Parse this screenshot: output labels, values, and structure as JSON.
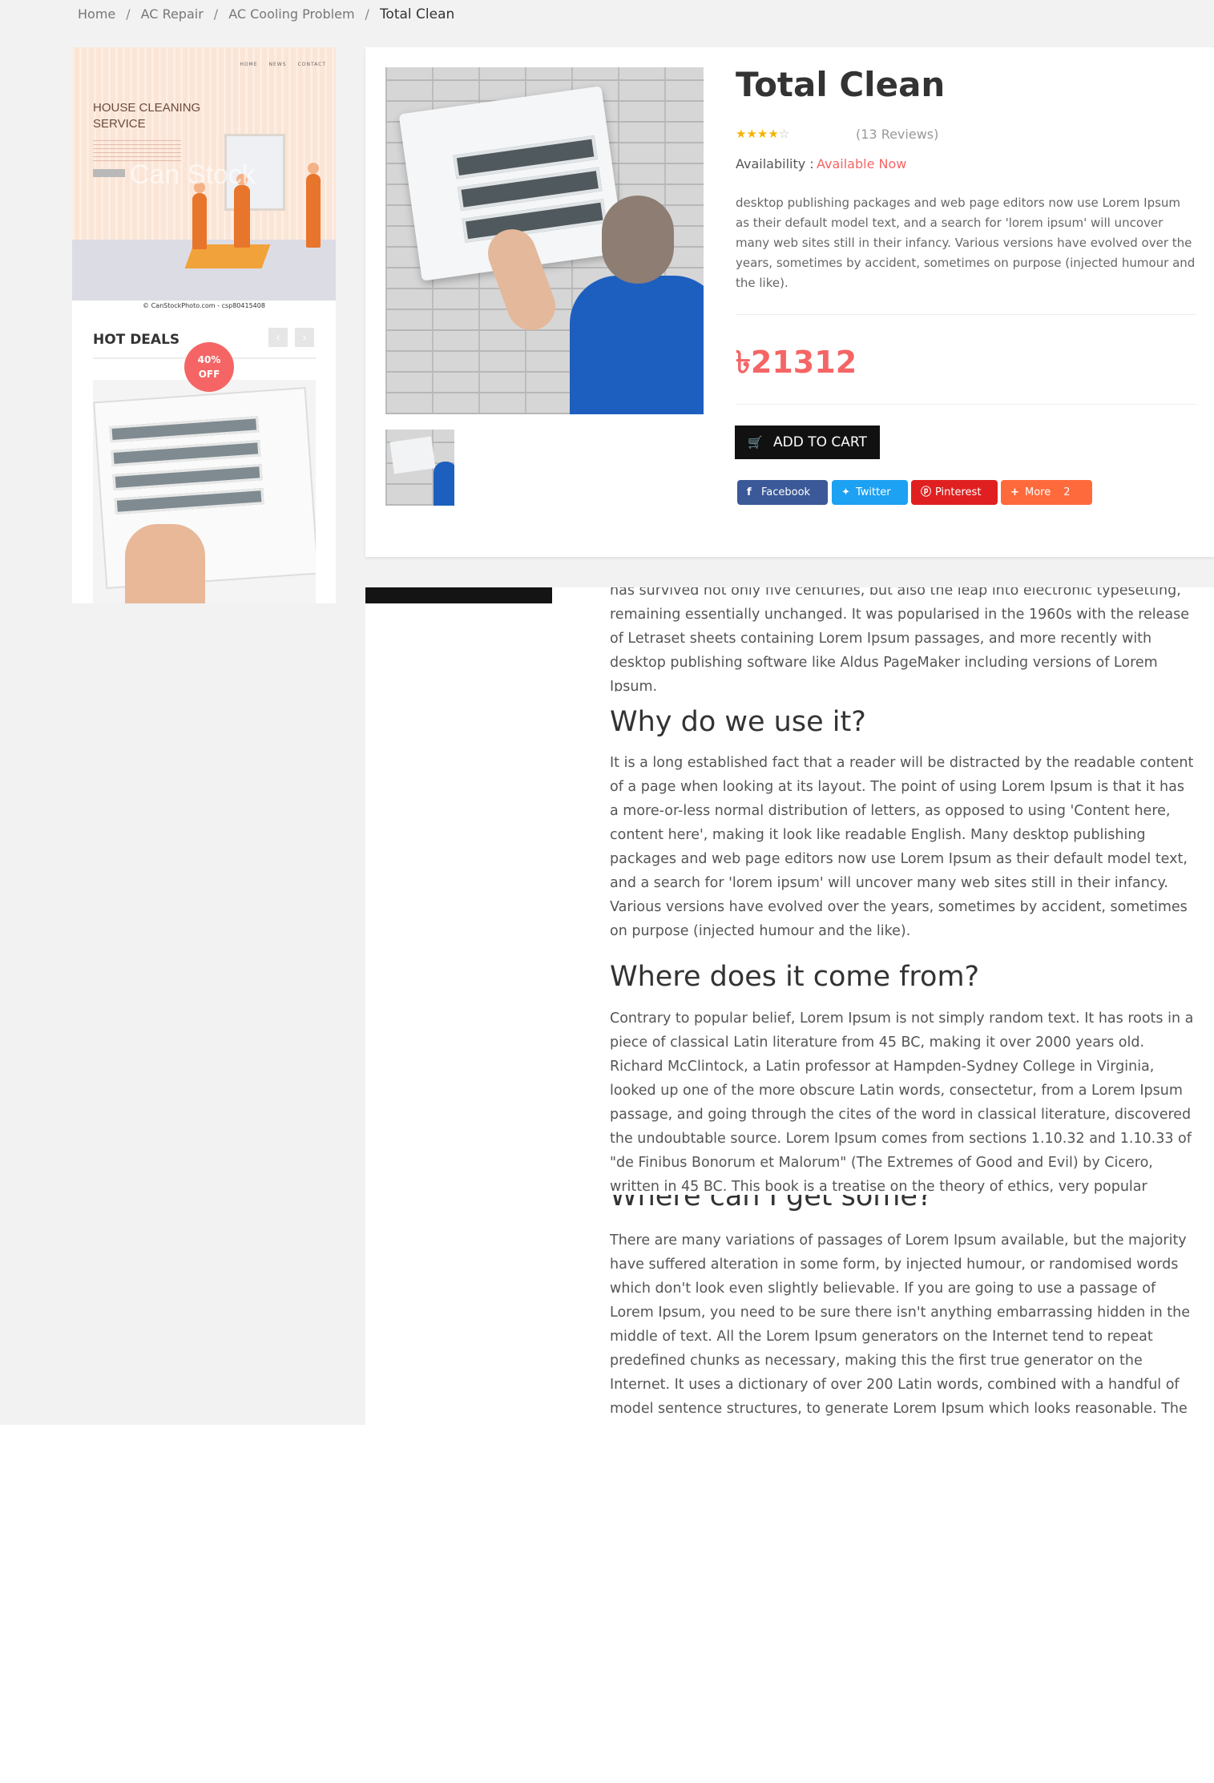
{
  "breadcrumb": {
    "items": [
      "Home",
      "AC Repair",
      "AC Cooling Problem"
    ],
    "current": "Total Clean",
    "separator": "/"
  },
  "sidebar": {
    "promo": {
      "nav": [
        "HOME",
        "NEWS",
        "CONTACT"
      ],
      "title": "HOUSE CLEANING SERVICE",
      "watermark": "Can Stock",
      "credit": "© CanStockPhoto.com - csp80415408"
    },
    "hot_deals": {
      "title": "HOT DEALS",
      "prev_icon": "chevron-left-icon",
      "next_icon": "chevron-right-icon",
      "badge_line1": "40%",
      "badge_line2": "OFF"
    }
  },
  "product": {
    "title": "Total Clean",
    "rating": 4,
    "rating_max": 5,
    "reviews": "(13 Reviews)",
    "availability_label": "Availability :",
    "availability_value": "Available Now",
    "description": "desktop publishing packages and web page editors now use Lorem Ipsum as their default model text, and a search for 'lorem ipsum' will uncover many web sites still in their infancy. Various versions have evolved over the years, sometimes by accident, sometimes on purpose (injected humour and the like).",
    "price": "৳21312",
    "add_to_cart": "ADD TO CART",
    "share": {
      "facebook": "Facebook",
      "twitter": "Twitter",
      "pinterest": "Pinterest",
      "more": "More",
      "more_count": "2"
    }
  },
  "colors": {
    "accent": "#f56565",
    "facebook": "#3b5998",
    "twitter": "#1da1f2",
    "pinterest": "#e02020",
    "more": "#ff6a3d",
    "stars": "#f5b301"
  },
  "content": {
    "intro_tail": "has survived not only five centuries, but also the leap into electronic typesetting, remaining essentially unchanged. It was popularised in the 1960s with the release of Letraset sheets containing Lorem Ipsum passages, and more recently with desktop publishing software like Aldus PageMaker including versions of Lorem Ipsum.",
    "sections": [
      {
        "heading": "Why do we use it?",
        "body": "It is a long established fact that a reader will be distracted by the readable content of a page when looking at its layout. The point of using Lorem Ipsum is that it has a more-or-less normal distribution of letters, as opposed to using 'Content here, content here', making it look like readable English. Many desktop publishing packages and web page editors now use Lorem Ipsum as their default model text, and a search for 'lorem ipsum' will uncover many web sites still in their infancy. Various versions have evolved over the years, sometimes by accident, sometimes on purpose (injected humour and the like)."
      },
      {
        "heading": "Where does it come from?",
        "body": "Contrary to popular belief, Lorem Ipsum is not simply random text. It has roots in a piece of classical Latin literature from 45 BC, making it over 2000 years old. Richard McClintock, a Latin professor at Hampden-Sydney College in Virginia, looked up one of the more obscure Latin words, consectetur, from a Lorem Ipsum passage, and going through the cites of the word in classical literature, discovered the undoubtable source. Lorem Ipsum comes from sections 1.10.32 and 1.10.33 of \"de Finibus Bonorum et Malorum\" (The Extremes of Good and Evil) by Cicero, written in 45 BC. This book is a treatise on the theory of ethics, very popular during the Renaissance. The first line of Lorem Ipsum,"
      },
      {
        "heading": "Where can I get some?",
        "body": "There are many variations of passages of Lorem Ipsum available, but the majority have suffered alteration in some form, by injected humour, or randomised words which don't look even slightly believable. If you are going to use a passage of Lorem Ipsum, you need to be sure there isn't anything embarrassing hidden in the middle of text. All the Lorem Ipsum generators on the Internet tend to repeat predefined chunks as necessary, making this the first true generator on the Internet. It uses a dictionary of over 200 Latin words, combined with a handful of model sentence structures, to generate Lorem Ipsum which looks reasonable. The generated Lorem Ipsum is therefore always free from"
      }
    ]
  }
}
